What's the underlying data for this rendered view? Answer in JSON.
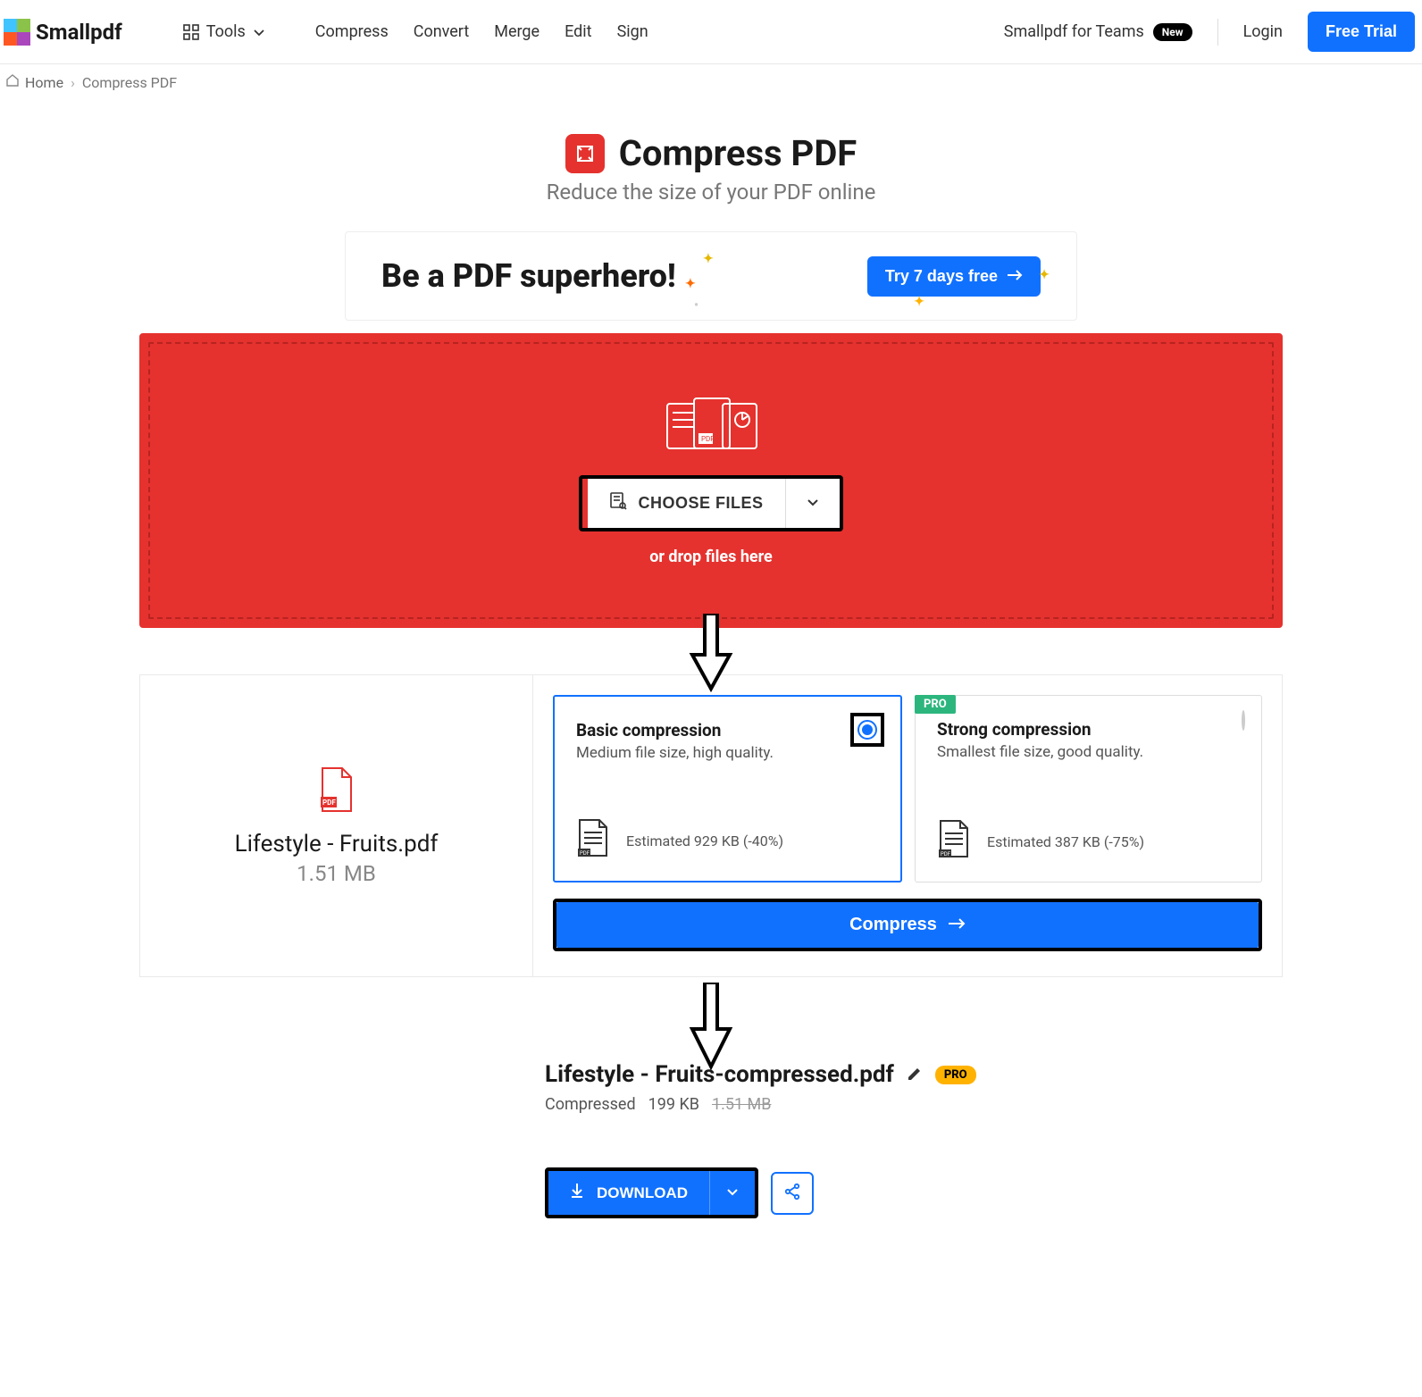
{
  "brand": {
    "name": "Smallpdf"
  },
  "nav": {
    "tools_label": "Tools",
    "items": [
      "Compress",
      "Convert",
      "Merge",
      "Edit",
      "Sign"
    ]
  },
  "header": {
    "teams_label": "Smallpdf for Teams",
    "teams_badge": "New",
    "login_label": "Login",
    "trial_label": "Free Trial"
  },
  "breadcrumb": {
    "home": "Home",
    "separator": "›",
    "current": "Compress PDF"
  },
  "page": {
    "title": "Compress PDF",
    "subtitle": "Reduce the size of your PDF online"
  },
  "promo": {
    "headline": "Be a PDF superhero!",
    "cta": "Try 7 days free"
  },
  "dropzone": {
    "choose_label": "CHOOSE FILES",
    "hint": "or drop files here"
  },
  "file": {
    "name": "Lifestyle - Fruits.pdf",
    "size": "1.51 MB"
  },
  "options": {
    "basic": {
      "title": "Basic compression",
      "subtitle": "Medium file size, high quality.",
      "estimate": "Estimated 929 KB (-40%)"
    },
    "strong": {
      "title": "Strong compression",
      "subtitle": "Smallest file size, good quality.",
      "estimate": "Estimated 387 KB (-75%)",
      "pro_label": "PRO"
    },
    "compress_label": "Compress"
  },
  "result": {
    "filename": "Lifestyle - Fruits-compressed.pdf",
    "pro_label": "PRO",
    "status": "Compressed",
    "new_size": "199 KB",
    "old_size": "1.51 MB",
    "download_label": "DOWNLOAD"
  },
  "colors": {
    "primary_red": "#e5322e",
    "primary_blue": "#1171ff",
    "pro_green": "#2cb67d",
    "pro_orange": "#ffb200"
  }
}
